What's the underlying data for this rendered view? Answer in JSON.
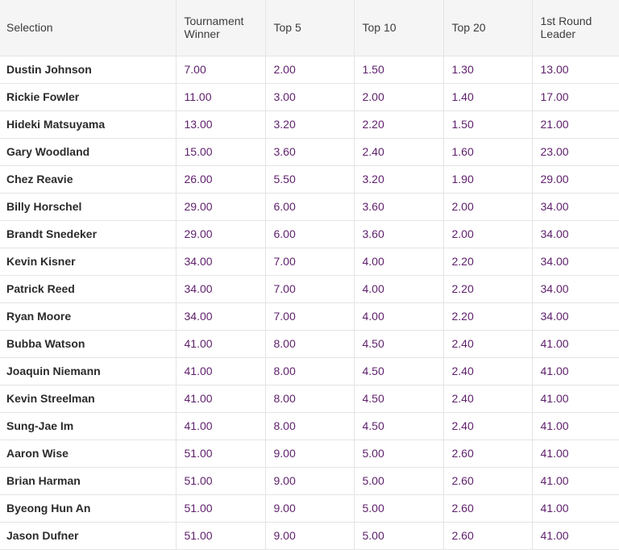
{
  "table": {
    "headers": [
      "Selection",
      "Tournament Winner",
      "Top 5",
      "Top 10",
      "Top 20",
      "1st Round Leader"
    ],
    "rows": [
      {
        "name": "Dustin Johnson",
        "odds": [
          "7.00",
          "2.00",
          "1.50",
          "1.30",
          "13.00"
        ]
      },
      {
        "name": "Rickie Fowler",
        "odds": [
          "11.00",
          "3.00",
          "2.00",
          "1.40",
          "17.00"
        ]
      },
      {
        "name": "Hideki Matsuyama",
        "odds": [
          "13.00",
          "3.20",
          "2.20",
          "1.50",
          "21.00"
        ]
      },
      {
        "name": "Gary Woodland",
        "odds": [
          "15.00",
          "3.60",
          "2.40",
          "1.60",
          "23.00"
        ]
      },
      {
        "name": "Chez Reavie",
        "odds": [
          "26.00",
          "5.50",
          "3.20",
          "1.90",
          "29.00"
        ]
      },
      {
        "name": "Billy Horschel",
        "odds": [
          "29.00",
          "6.00",
          "3.60",
          "2.00",
          "34.00"
        ]
      },
      {
        "name": "Brandt Snedeker",
        "odds": [
          "29.00",
          "6.00",
          "3.60",
          "2.00",
          "34.00"
        ]
      },
      {
        "name": "Kevin Kisner",
        "odds": [
          "34.00",
          "7.00",
          "4.00",
          "2.20",
          "34.00"
        ]
      },
      {
        "name": "Patrick Reed",
        "odds": [
          "34.00",
          "7.00",
          "4.00",
          "2.20",
          "34.00"
        ]
      },
      {
        "name": "Ryan Moore",
        "odds": [
          "34.00",
          "7.00",
          "4.00",
          "2.20",
          "34.00"
        ]
      },
      {
        "name": "Bubba Watson",
        "odds": [
          "41.00",
          "8.00",
          "4.50",
          "2.40",
          "41.00"
        ]
      },
      {
        "name": "Joaquin Niemann",
        "odds": [
          "41.00",
          "8.00",
          "4.50",
          "2.40",
          "41.00"
        ]
      },
      {
        "name": "Kevin Streelman",
        "odds": [
          "41.00",
          "8.00",
          "4.50",
          "2.40",
          "41.00"
        ]
      },
      {
        "name": "Sung-Jae Im",
        "odds": [
          "41.00",
          "8.00",
          "4.50",
          "2.40",
          "41.00"
        ]
      },
      {
        "name": "Aaron Wise",
        "odds": [
          "51.00",
          "9.00",
          "5.00",
          "2.60",
          "41.00"
        ]
      },
      {
        "name": "Brian Harman",
        "odds": [
          "51.00",
          "9.00",
          "5.00",
          "2.60",
          "41.00"
        ]
      },
      {
        "name": "Byeong Hun An",
        "odds": [
          "51.00",
          "9.00",
          "5.00",
          "2.60",
          "41.00"
        ]
      },
      {
        "name": "Jason Dufner",
        "odds": [
          "51.00",
          "9.00",
          "5.00",
          "2.60",
          "41.00"
        ]
      }
    ]
  },
  "colors": {
    "price_text": "#5e1f6b",
    "header_bg": "#f5f5f5",
    "border": "#e4e4e4"
  }
}
